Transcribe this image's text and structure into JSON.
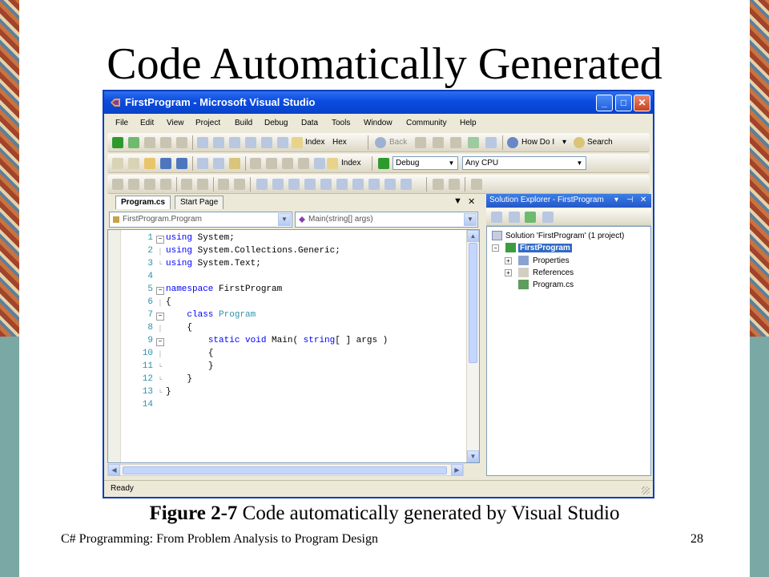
{
  "slide": {
    "title": "Code Automatically Generated",
    "caption_figure": "Figure 2-7",
    "caption_text": " Code automatically generated by Visual Studio",
    "footer_left": "C# Programming: From Problem Analysis to Program Design",
    "page_number": "28",
    "side_colors": {
      "photo": "#a2432b",
      "teal": "#7aa8a5"
    }
  },
  "window": {
    "title": "FirstProgram - Microsoft Visual Studio",
    "controls": [
      "_",
      "□",
      "✕"
    ],
    "menu": [
      "File",
      "Edit",
      "View",
      "Project",
      "Build",
      "Debug",
      "Data",
      "Tools",
      "Window",
      "Community",
      "Help"
    ],
    "toolbar1": {
      "index_label": "Index",
      "hex_label": "Hex",
      "back_label": "Back",
      "how_do_i": "How Do I",
      "search": "Search"
    },
    "toolbar2": {
      "index_label": "Index",
      "config": "Debug",
      "platform": "Any CPU"
    },
    "editor": {
      "tabs": [
        "Program.cs",
        "Start Page"
      ],
      "class_combo": "FirstProgram.Program",
      "member_combo": "Main(string[] args)",
      "line_numbers": [
        "1",
        "2",
        "3",
        "4",
        "5",
        "6",
        "7",
        "8",
        "9",
        "10",
        "11",
        "12",
        "13",
        "14"
      ],
      "code": {
        "l1_kw": "using",
        "l1_rest": " System;",
        "l2_kw": "using",
        "l2_rest": " System.Collections.Generic;",
        "l3_kw": "using",
        "l3_rest": " System.Text;",
        "l5_kw": "namespace",
        "l5_rest": " FirstProgram",
        "l6": "{",
        "l7_kw": "class",
        "l7_type": " Program",
        "l8": "{",
        "l9_kw": "static void",
        "l9_rest": " Main( ",
        "l9_kw2": "string",
        "l9_rest2": "[ ] args )",
        "l10": "{",
        "l11": "}",
        "l12": "}",
        "l13": "}"
      }
    },
    "solution_explorer": {
      "header": "Solution Explorer - FirstProgram",
      "solution": "Solution 'FirstProgram' (1 project)",
      "project": "FirstProgram",
      "properties": "Properties",
      "references": "References",
      "file": "Program.cs"
    },
    "status": "Ready"
  }
}
